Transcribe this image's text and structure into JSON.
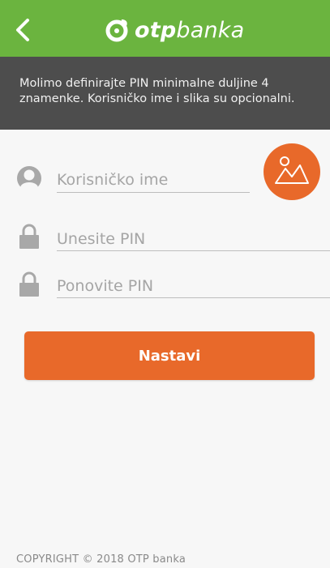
{
  "header": {
    "brand_bold": "otp",
    "brand_light": "banka",
    "background": "#6bb43f"
  },
  "notice": {
    "text": "Molimo definirajte PIN minimalne duljine 4 znamenke. Korisničko ime i slika su opcionalni.",
    "background": "#4d4d4d"
  },
  "form": {
    "username_placeholder": "Korisničko ime",
    "pin_placeholder": "Unesite PIN",
    "pin_repeat_placeholder": "Ponovite PIN",
    "submit_label": "Nastavi",
    "accent": "#e8692a"
  },
  "footer": {
    "copyright": "COPYRIGHT © 2018 OTP banka"
  },
  "icons": [
    "back-chevron-icon",
    "otp-logo-icon",
    "user-avatar-icon",
    "image-icon",
    "lock-icon"
  ]
}
